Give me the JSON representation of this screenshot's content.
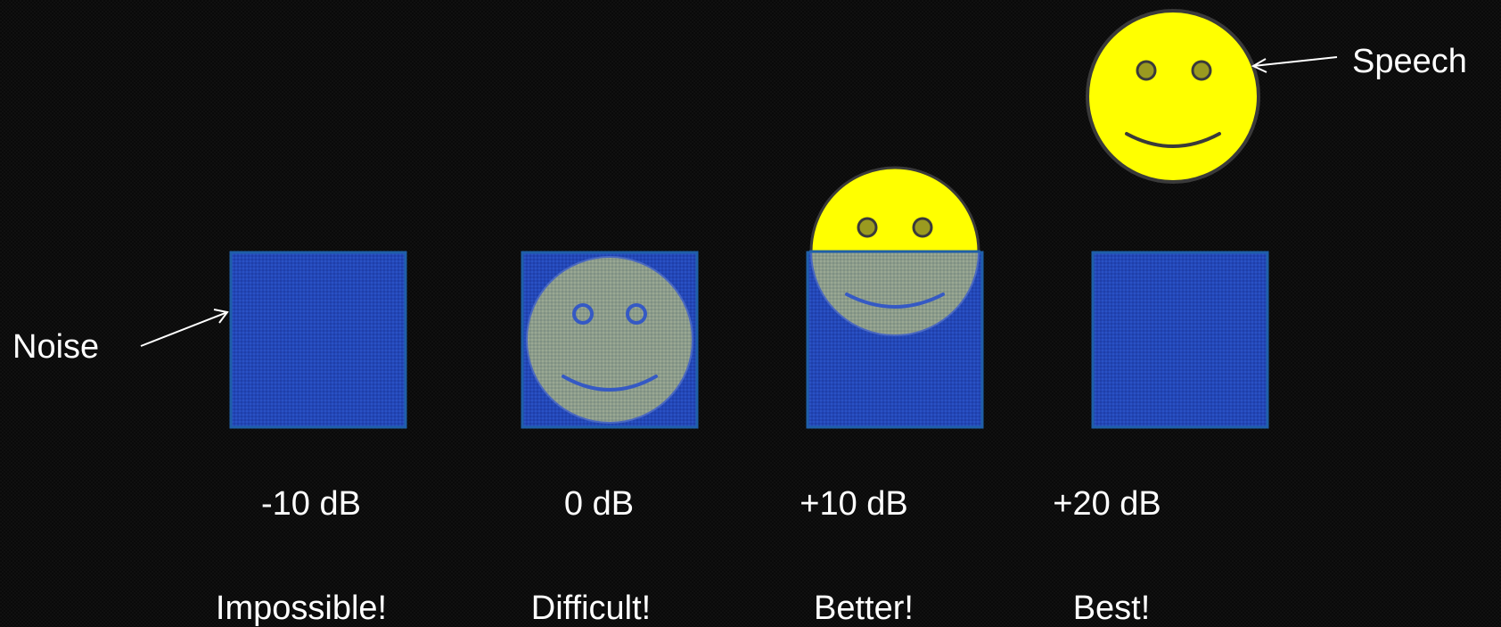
{
  "labels": {
    "noise": "Noise",
    "speech": "Speech"
  },
  "conditions": [
    {
      "snr": "-10 dB",
      "verdict": "Impossible!"
    },
    {
      "snr": "0 dB",
      "verdict": "Difficult!"
    },
    {
      "snr": "+10 dB",
      "verdict": "Better!"
    },
    {
      "snr": "+20 dB",
      "verdict": "Best!"
    }
  ],
  "colors": {
    "background": "#0a0a0a",
    "noise_box": "#2347b8",
    "noise_border": "#1f5fa8",
    "face": "#ffff00",
    "face_outline": "#3a3a3a",
    "eye": "#9a9a20",
    "text": "#ffffff"
  },
  "icons": {
    "face": "smiley-face-icon",
    "arrow": "arrow-icon"
  }
}
